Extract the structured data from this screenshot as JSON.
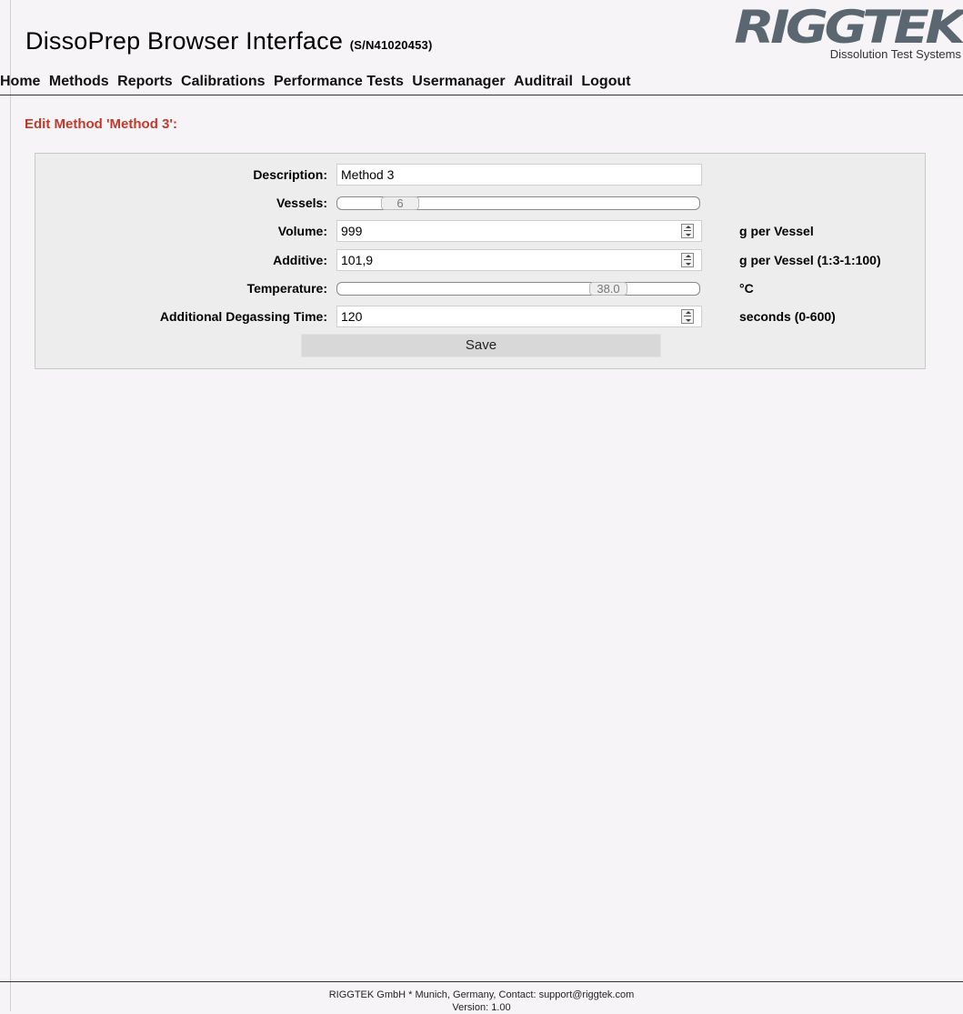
{
  "header": {
    "title": "DissoPrep Browser Interface",
    "serial": "(S/N41020453)",
    "logo_text": "RIGGTEK",
    "logo_subtitle": "Dissolution Test Systems"
  },
  "nav": [
    "Home",
    "Methods",
    "Reports",
    "Calibrations",
    "Performance Tests",
    "Usermanager",
    "Auditrail",
    "Logout"
  ],
  "page": {
    "heading": "Edit Method 'Method 3':"
  },
  "form": {
    "description": {
      "label": "Description:",
      "value": "Method 3"
    },
    "vessels": {
      "label": "Vessels:",
      "value": "6",
      "level": 0.0
    },
    "volume": {
      "label": "Volume:",
      "value": "999",
      "unit": "g per Vessel"
    },
    "additive": {
      "label": "Additive:",
      "value": "101,9",
      "unit": "g per Vessel (1:3-1:100)"
    },
    "temperature": {
      "label": "Temperature:",
      "value": "38.0",
      "unit": "°C",
      "level": 0.8
    },
    "degassing": {
      "label": "Additional Degassing Time:",
      "value": "120",
      "unit": "seconds (0-600)"
    },
    "save_label": "Save"
  },
  "footer": {
    "line1": "RIGGTEK GmbH * Munich, Germany, Contact: support@riggtek.com",
    "line2": "Version: 1.00"
  },
  "colors": {
    "heading": "#c0392b",
    "background": "#f7f4f7",
    "panel": "#ededee"
  }
}
